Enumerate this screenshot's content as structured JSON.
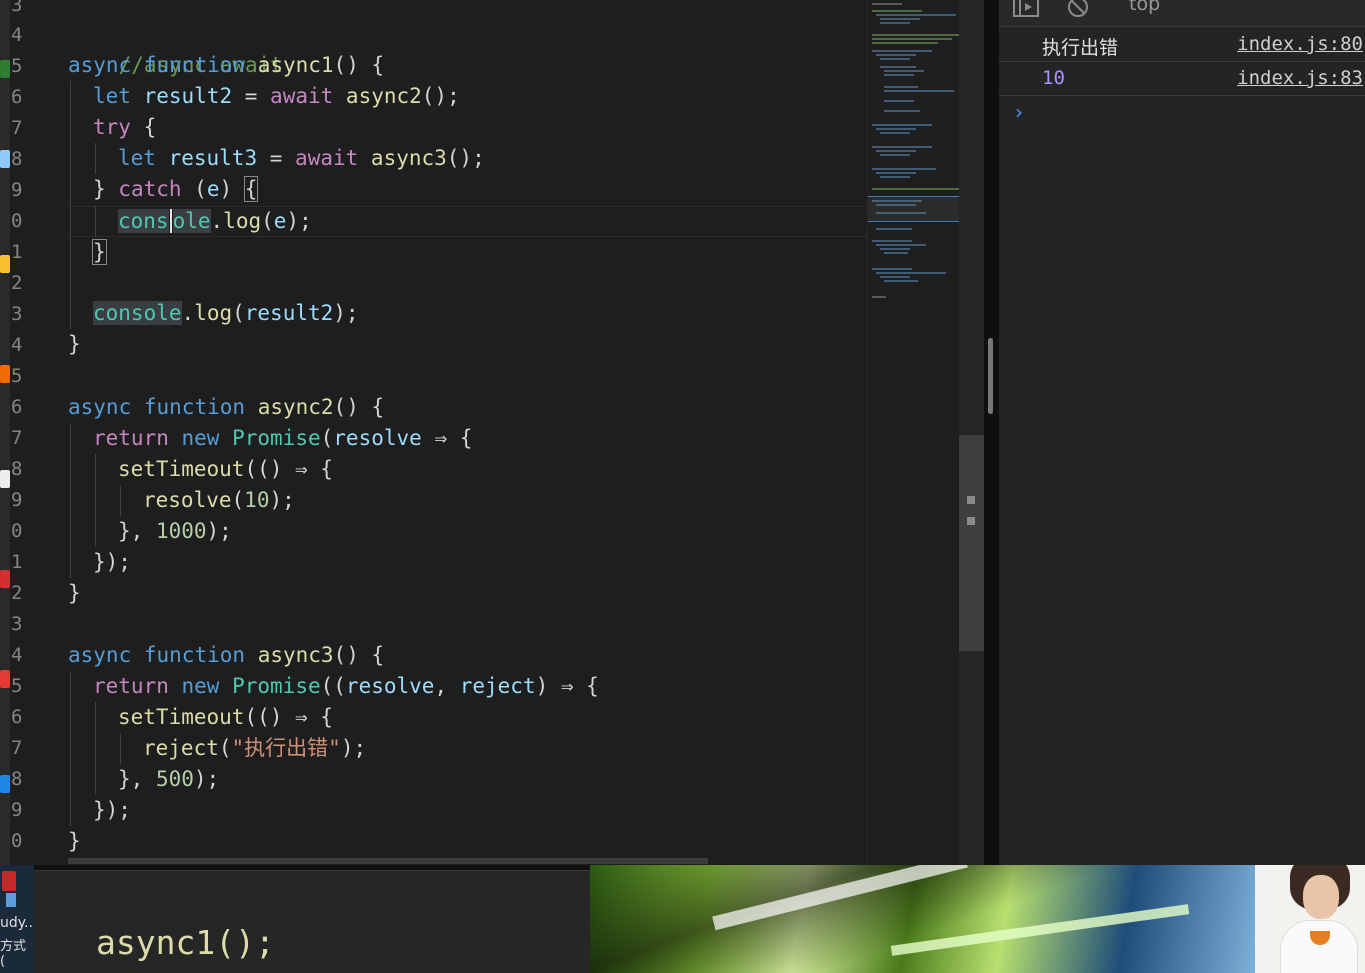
{
  "editor": {
    "line_numbers": [
      "3",
      "4",
      "5",
      "6",
      "7",
      "8",
      "9",
      "0",
      "1",
      "2",
      "3",
      "4",
      "5",
      "6",
      "7",
      "8",
      "9",
      "0",
      "1",
      "2",
      "3",
      "4",
      "5",
      "6",
      "7",
      "8",
      "9",
      "0"
    ],
    "comment": "//async await",
    "code": {
      "l1_kw": "async",
      "l1_fnkw": "function",
      "l1_name": "async1",
      "l1_tail": "() {",
      "l2_let": "let",
      "l2_var": "result2",
      "l2_eq": " = ",
      "l2_await": "await",
      "l2_call": "async2",
      "l2_tail": "();",
      "l3_try": "try",
      "l3_tail": " {",
      "l4_let": "let",
      "l4_var": "result3",
      "l4_eq": " = ",
      "l4_await": "await",
      "l4_call": "async3",
      "l4_tail": "();",
      "l5_open": "} ",
      "l5_catch": "catch",
      "l5_paren": " (",
      "l5_e": "e",
      "l5_close": ") ",
      "l5_brace": "{",
      "l6_obj_a": "cons",
      "l6_obj_b": "ole",
      "l6_dot": ".",
      "l6_log": "log",
      "l6_paren": "(",
      "l6_e": "e",
      "l6_tail": ");",
      "l7_brace": "}",
      "l9_obj": "console",
      "l9_dot": ".",
      "l9_log": "log",
      "l9_paren": "(",
      "l9_var": "result2",
      "l9_tail": ");",
      "l10_brace": "}",
      "l12_kw": "async",
      "l12_fnkw": "function",
      "l12_name": "async2",
      "l12_tail": "() {",
      "l13_return": "return",
      "l13_new": "new",
      "l13_cls": "Promise",
      "l13_paren": "(",
      "l13_param": "resolve",
      "l13_arrow": " ⇒ {",
      "l14_fn": "setTimeout",
      "l14_tail": "(() ⇒ {",
      "l15_fn": "resolve",
      "l15_paren": "(",
      "l15_num": "10",
      "l15_tail": ");",
      "l16_head": "}, ",
      "l16_num": "1000",
      "l16_tail": ");",
      "l17": "});",
      "l18": "}",
      "l20_kw": "async",
      "l20_fnkw": "function",
      "l20_name": "async3",
      "l20_tail": "() {",
      "l21_return": "return",
      "l21_new": "new",
      "l21_cls": "Promise",
      "l21_paren": "((",
      "l21_p1": "resolve",
      "l21_comma": ", ",
      "l21_p2": "reject",
      "l21_arrow": ") ⇒ {",
      "l22_fn": "setTimeout",
      "l22_tail": "(() ⇒ {",
      "l23_fn": "reject",
      "l23_paren": "(",
      "l23_str": "\"执行出错\"",
      "l23_tail": ");",
      "l24_head": "}, ",
      "l24_num": "500",
      "l24_tail": ");",
      "l25": "});",
      "l26": "}"
    }
  },
  "console": {
    "context": "top",
    "logs": [
      {
        "message": "执行出错",
        "source": "index.js:80"
      },
      {
        "message": "10",
        "source": "index.js:83"
      }
    ],
    "prompt_glyph": "›"
  },
  "bottom": {
    "zoom_code": "async1();",
    "taskbar_label_1": "udy..",
    "taskbar_label_2": "方式 ("
  },
  "icons": [
    "play-pause-icon",
    "clear-console-icon",
    "prompt-chevron-icon"
  ]
}
